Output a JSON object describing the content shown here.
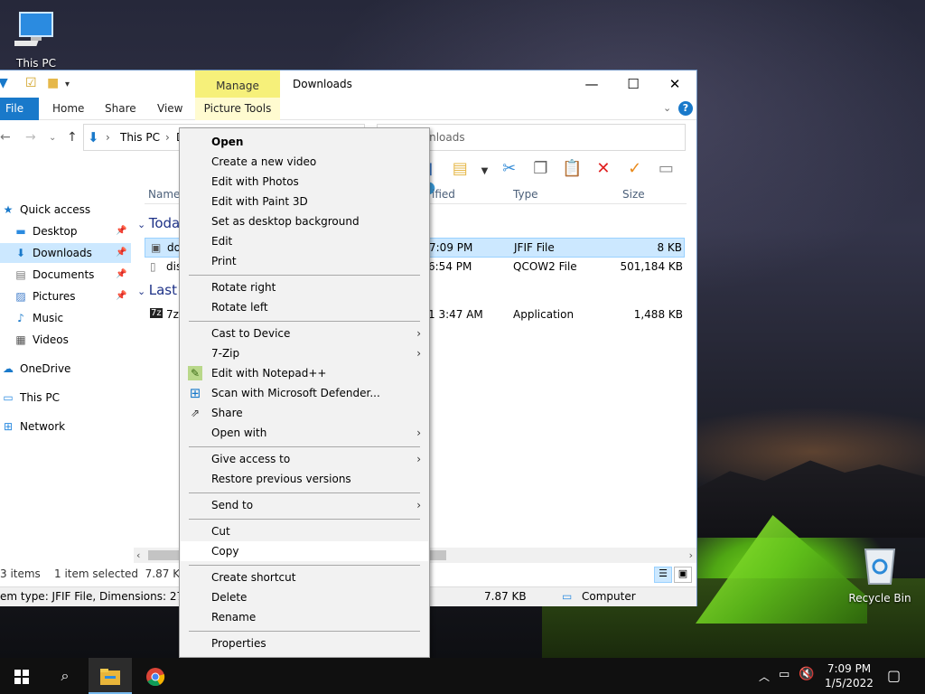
{
  "desktop": {
    "icons": [
      {
        "label": "This PC",
        "icon": "this-pc-icon"
      },
      {
        "label": "Recycle Bin",
        "icon": "recycle-bin-icon"
      }
    ]
  },
  "window": {
    "title": "Downloads",
    "manage_tab": "Manage",
    "ribbon_tabs": [
      "File",
      "Home",
      "Share",
      "View",
      "Picture Tools"
    ],
    "breadcrumb": [
      "This PC",
      "D"
    ],
    "search_placeholder": "rch Downloads",
    "nav": [
      {
        "label": "Quick access",
        "icon": "star-icon"
      },
      {
        "label": "Desktop",
        "icon": "desktop-icon",
        "pinned": true
      },
      {
        "label": "Downloads",
        "icon": "download-arrow-icon",
        "pinned": true,
        "selected": true
      },
      {
        "label": "Documents",
        "icon": "documents-icon",
        "pinned": true
      },
      {
        "label": "Pictures",
        "icon": "pictures-icon",
        "pinned": true
      },
      {
        "label": "Music",
        "icon": "music-icon"
      },
      {
        "label": "Videos",
        "icon": "videos-icon"
      },
      {
        "label": "OneDrive",
        "icon": "cloud-icon"
      },
      {
        "label": "This PC",
        "icon": "this-pc-icon"
      },
      {
        "label": "Network",
        "icon": "network-icon"
      }
    ],
    "columns": {
      "name": "Name",
      "modified": "ified",
      "type": "Type",
      "size": "Size"
    },
    "groups": [
      "Toda",
      "Last"
    ],
    "files": [
      {
        "name": "do",
        "modified": "7:09 PM",
        "type": "JFIF File",
        "size": "8 KB",
        "selected": true
      },
      {
        "name": "dis",
        "modified": "6:54 PM",
        "type": "QCOW2 File",
        "size": "501,184 KB"
      },
      {
        "name": "7z",
        "modified": "1 3:47 AM",
        "type": "Application",
        "size": "1,488 KB"
      }
    ],
    "status": {
      "items": "3 items",
      "selected": "1 item selected  7.87 KB"
    },
    "details": {
      "type_info": "em type: JFIF File, Dimensions: 273 x 18",
      "size": "7.87 KB",
      "location": "Computer"
    }
  },
  "context_menu": {
    "items": [
      {
        "label": "Open",
        "bold": true
      },
      {
        "label": "Create a new video"
      },
      {
        "label": "Edit with Photos"
      },
      {
        "label": "Edit with Paint 3D"
      },
      {
        "label": "Set as desktop background"
      },
      {
        "label": "Edit"
      },
      {
        "label": "Print"
      },
      {
        "separator": true
      },
      {
        "label": "Rotate right"
      },
      {
        "label": "Rotate left"
      },
      {
        "separator": true
      },
      {
        "label": "Cast to Device",
        "submenu": true
      },
      {
        "label": "7-Zip",
        "submenu": true
      },
      {
        "label": "Edit with Notepad++",
        "icon": "notepad-plus-icon"
      },
      {
        "label": "Scan with Microsoft Defender...",
        "icon": "defender-icon"
      },
      {
        "label": "Share",
        "icon": "share-icon"
      },
      {
        "label": "Open with",
        "submenu": true
      },
      {
        "separator": true
      },
      {
        "label": "Give access to",
        "submenu": true
      },
      {
        "label": "Restore previous versions"
      },
      {
        "separator": true
      },
      {
        "label": "Send to",
        "submenu": true
      },
      {
        "separator": true
      },
      {
        "label": "Cut"
      },
      {
        "label": "Copy",
        "highlighted": true
      },
      {
        "separator": true
      },
      {
        "label": "Create shortcut"
      },
      {
        "label": "Delete"
      },
      {
        "label": "Rename"
      },
      {
        "separator": true
      },
      {
        "label": "Properties"
      }
    ]
  },
  "taskbar": {
    "clock_time": "7:09 PM",
    "clock_date": "1/5/2022",
    "apps": [
      "start-icon",
      "search-icon",
      "file-explorer-icon",
      "chrome-icon"
    ]
  }
}
